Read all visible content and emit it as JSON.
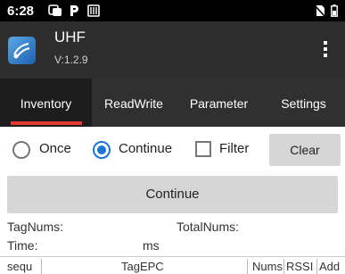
{
  "status_bar": {
    "time": "6:28",
    "icons": [
      "notification-icon",
      "parking-app-icon",
      "media-icon",
      "no-sim-icon",
      "battery-icon"
    ]
  },
  "app_bar": {
    "title": "UHF",
    "version": "V:1.2.9",
    "logo": "uhf-logo-icon",
    "menu": "overflow-menu-icon"
  },
  "tabs": [
    {
      "label": "Inventory",
      "active": true
    },
    {
      "label": "ReadWrite",
      "active": false
    },
    {
      "label": "Parameter",
      "active": false
    },
    {
      "label": "Settings",
      "active": false
    }
  ],
  "options": {
    "once_label": "Once",
    "continue_label": "Continue",
    "filter_label": "Filter",
    "clear_label": "Clear",
    "selected": "Continue",
    "filter_checked": false
  },
  "action": {
    "continue_label": "Continue"
  },
  "stats": {
    "tag_nums_label": "TagNums:",
    "total_nums_label": "TotalNums:",
    "time_label": "Time:",
    "time_unit": "ms"
  },
  "table": {
    "columns": [
      "sequ",
      "TagEPC",
      "Nums",
      "RSSI",
      "Add"
    ]
  },
  "colors": {
    "accent": "#1976d2",
    "tab_indicator": "#e53935",
    "app_bar": "#2d2d2d",
    "tab_bar": "#303030"
  }
}
